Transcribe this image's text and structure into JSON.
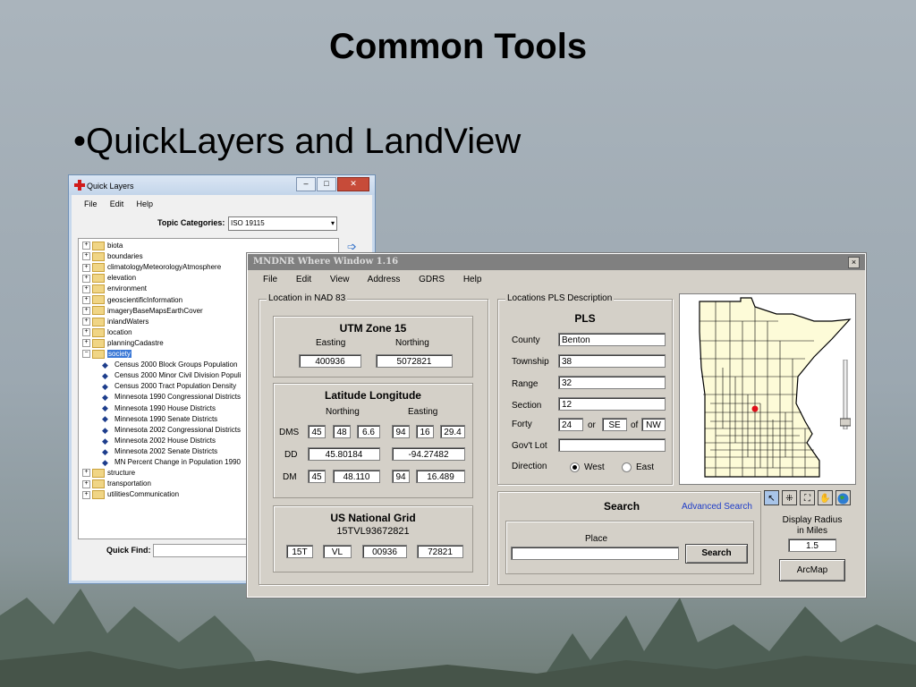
{
  "slide": {
    "title": "Common Tools",
    "bullet": "•QuickLayers and LandView"
  },
  "quick_layers": {
    "window_title": "Quick Layers",
    "menu": [
      "File",
      "Edit",
      "Help"
    ],
    "topic_categories_label": "Topic Categories:",
    "topic_categories_value": "ISO 19115",
    "tree": [
      {
        "label": "biota",
        "type": "folder",
        "expanded": false
      },
      {
        "label": "boundaries",
        "type": "folder",
        "expanded": false
      },
      {
        "label": "climatologyMeteorologyAtmosphere",
        "type": "folder",
        "expanded": false
      },
      {
        "label": "elevation",
        "type": "folder",
        "expanded": false
      },
      {
        "label": "environment",
        "type": "folder",
        "expanded": false
      },
      {
        "label": "geoscientificInformation",
        "type": "folder",
        "expanded": false
      },
      {
        "label": "imageryBaseMapsEarthCover",
        "type": "folder",
        "expanded": false
      },
      {
        "label": "inlandWaters",
        "type": "folder",
        "expanded": false
      },
      {
        "label": "location",
        "type": "folder",
        "expanded": false
      },
      {
        "label": "planningCadastre",
        "type": "folder",
        "expanded": false
      },
      {
        "label": "society",
        "type": "folder",
        "expanded": true,
        "selected": true
      },
      {
        "label": "Census 2000 Block Groups Population",
        "type": "layer"
      },
      {
        "label": "Census 2000 Minor Civil Division Populi",
        "type": "layer"
      },
      {
        "label": "Census 2000 Tract Population Density",
        "type": "layer"
      },
      {
        "label": "Minnesota 1990 Congressional Districts",
        "type": "layer"
      },
      {
        "label": "Minnesota 1990 House Districts",
        "type": "layer"
      },
      {
        "label": "Minnesota 1990 Senate Districts",
        "type": "layer"
      },
      {
        "label": "Minnesota 2002 Congressional Districts",
        "type": "layer"
      },
      {
        "label": "Minnesota 2002 House Districts",
        "type": "layer"
      },
      {
        "label": "Minnesota 2002 Senate Districts",
        "type": "layer"
      },
      {
        "label": "MN Percent Change in Population 1990",
        "type": "layer"
      },
      {
        "label": "structure",
        "type": "folder",
        "expanded": false
      },
      {
        "label": "transportation",
        "type": "folder",
        "expanded": false
      },
      {
        "label": "utilitiesCommunication",
        "type": "folder",
        "expanded": false
      }
    ],
    "quick_find_label": "Quick Find:"
  },
  "where_window": {
    "window_title": "MNDNR Where Window 1.16",
    "menu": [
      "File",
      "Edit",
      "View",
      "Address",
      "GDRS",
      "Help"
    ],
    "nad83": {
      "group_label": "Location in NAD 83",
      "utm": {
        "title": "UTM Zone 15",
        "easting_label": "Easting",
        "northing_label": "Northing",
        "easting": "400936",
        "northing": "5072821"
      },
      "latlon": {
        "title": "Latitude Longitude",
        "northing_label": "Northing",
        "easting_label": "Easting",
        "dms_label": "DMS",
        "dd_label": "DD",
        "dm_label": "DM",
        "dms_n": [
          "45",
          "48",
          "6.6"
        ],
        "dms_e": [
          "94",
          "16",
          "29.4"
        ],
        "dd_n": "45.80184",
        "dd_e": "-94.27482",
        "dm_n": [
          "45",
          "48.110"
        ],
        "dm_e": [
          "94",
          "16.489"
        ]
      },
      "usng": {
        "title": "US National Grid",
        "code": "15TVL93672821",
        "parts": [
          "15T",
          "VL",
          "00936",
          "72821"
        ]
      }
    },
    "pls": {
      "group_label": "Locations PLS Description",
      "title": "PLS",
      "county_label": "County",
      "county": "Benton",
      "township_label": "Township",
      "township": "38",
      "range_label": "Range",
      "range": "32",
      "section_label": "Section",
      "section": "12",
      "forty_label": "Forty",
      "forty": "24",
      "or_label": "or",
      "forty_q": "SE",
      "of_label": "of",
      "forty_of": "NW",
      "govt_lot_label": "Gov't Lot",
      "govt_lot": "",
      "direction_label": "Direction",
      "west_label": "West",
      "east_label": "East",
      "direction": "West"
    },
    "search": {
      "title": "Search",
      "advanced_link": "Advanced Search",
      "place_label": "Place",
      "place_value": "",
      "button": "Search"
    },
    "radius": {
      "label_line1": "Display Radius",
      "label_line2": "in Miles",
      "value": "1.5"
    },
    "arcmap_button": "ArcMap",
    "colors": {
      "marker": "#e0101a",
      "map_fill": "#fdfbd8"
    }
  }
}
